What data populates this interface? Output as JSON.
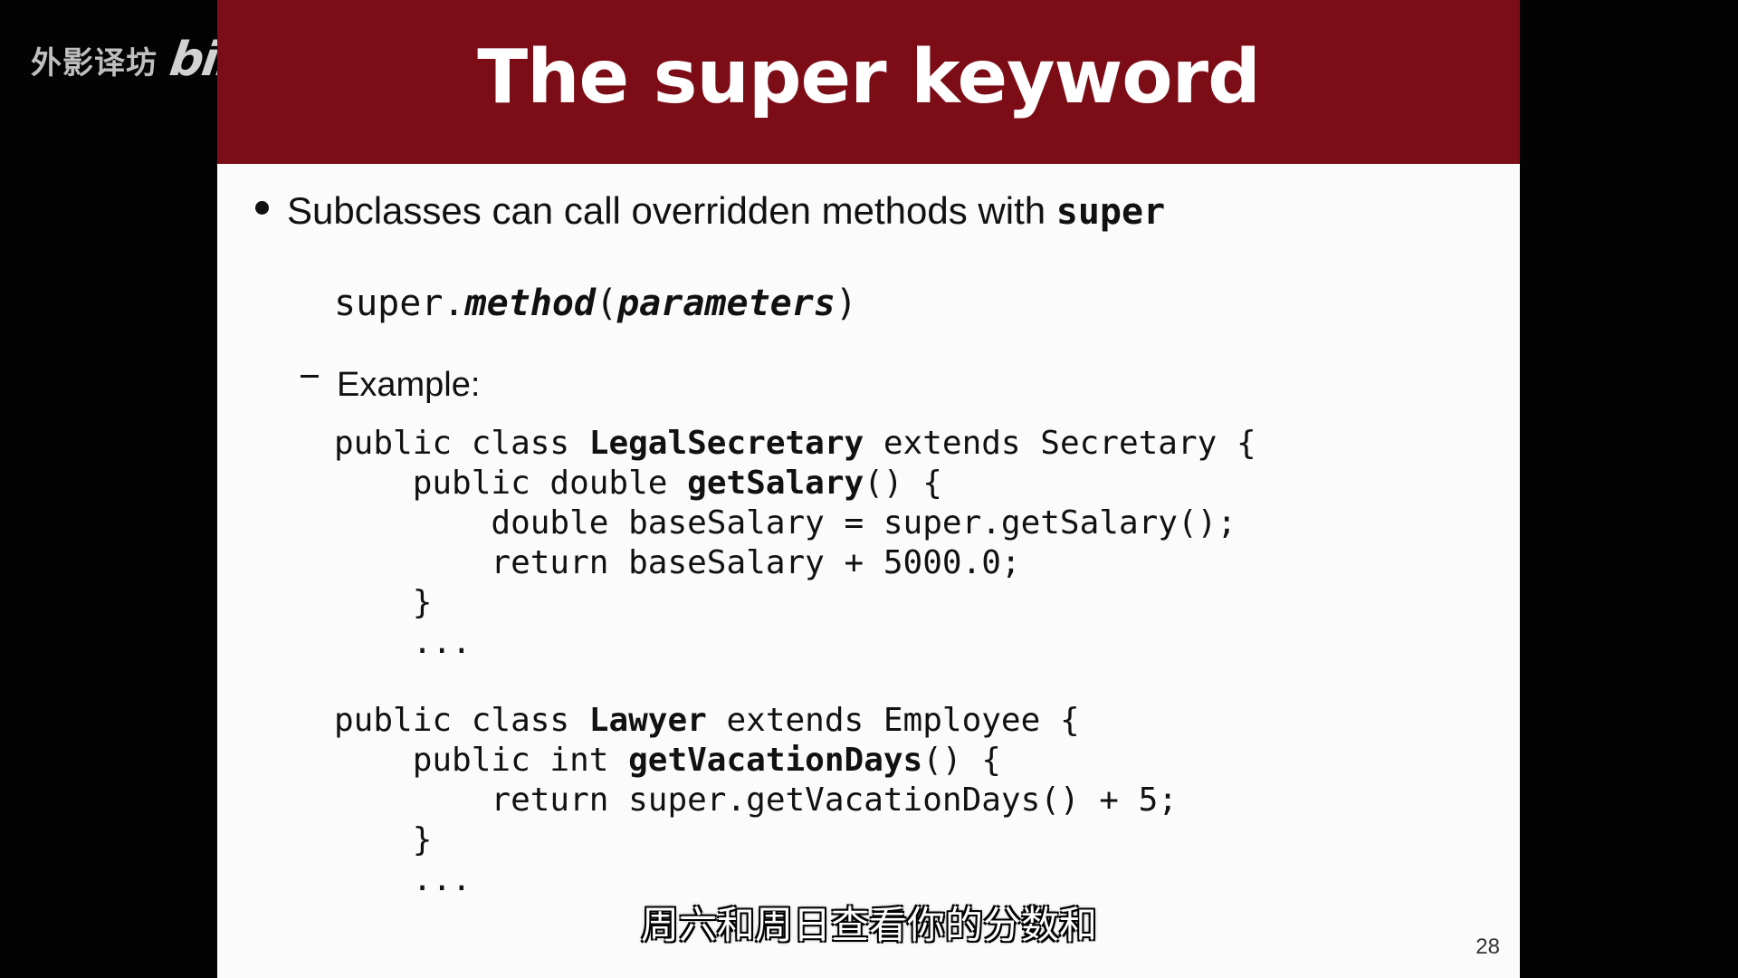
{
  "watermark": {
    "channel_text": "外影译坊",
    "platform_logo": "bilibili"
  },
  "slide": {
    "title": "The super keyword",
    "bullet_text": "Subclasses can call overridden methods with ",
    "bullet_keyword": "super",
    "syntax": {
      "prefix": "super.",
      "method": "method",
      "open": "(",
      "params": "parameters",
      "close": ")"
    },
    "example_label": "Example:",
    "code": {
      "line1_a": "public class ",
      "line1_b": "LegalSecretary",
      "line1_c": " extends Secretary {",
      "line2_a": "    public double ",
      "line2_b": "getSalary",
      "line2_c": "() {",
      "line3": "        double baseSalary = super.getSalary();",
      "line4": "        return baseSalary + 5000.0;",
      "line5": "    }",
      "line6": "    ...",
      "line7_a": "public class ",
      "line7_b": "Lawyer",
      "line7_c": " extends Employee {",
      "line8_a": "    public int ",
      "line8_b": "getVacationDays",
      "line8_c": "() {",
      "line9": "        return super.getVacationDays() + 5;",
      "line10": "    }",
      "line11": "    ..."
    },
    "page_number": "28"
  },
  "subtitle": "周六和周日查看你的分数和"
}
